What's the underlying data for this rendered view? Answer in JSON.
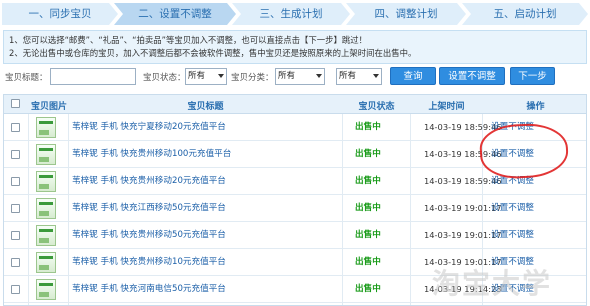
{
  "steps": [
    {
      "label": "一、同步宝贝",
      "active": false
    },
    {
      "label": "二、设置不调整",
      "active": true
    },
    {
      "label": "三、生成计划",
      "active": false
    },
    {
      "label": "四、调整计划",
      "active": false
    },
    {
      "label": "五、启动计划",
      "active": false
    }
  ],
  "notice": {
    "line1": "1、您可以选择“邮费”、“礼品”、“拍卖品”等宝贝加入不调整，也可以直接点击【下一步】跳过！",
    "line2": "2、无论出售中或仓库的宝贝，加入不调整后都不会被软件调整，售中宝贝还是按照原来的上架时间在出售中。"
  },
  "filter": {
    "title_label": "宝贝标题：",
    "title_value": "",
    "status_label": "宝贝状态：",
    "status_value": "所有",
    "category_label": "宝贝分类：",
    "category_value": "所有",
    "extra_value": "所有",
    "query_button": "查询",
    "set_button": "设置不调整",
    "next_button": "下一步"
  },
  "table": {
    "headers": {
      "image": "宝贝图片",
      "title": "宝贝标题",
      "status": "宝贝状态",
      "time": "上架时间",
      "op": "操作"
    },
    "rows": [
      {
        "title": "苇梓铌 手机 快充宁夏移动20元充值平台",
        "status": "出售中",
        "time": "14-03-19 18:59:46",
        "op": "设置不调整"
      },
      {
        "title": "苇梓铌 手机 快充贵州移动100元充值平台",
        "status": "出售中",
        "time": "14-03-19 18:59:46",
        "op": "设置不调整"
      },
      {
        "title": "苇梓铌 手机 快充贵州移动20元充值平台",
        "status": "出售中",
        "time": "14-03-19 18:59:46",
        "op": "设置不调整"
      },
      {
        "title": "苇梓铌 手机 快充江西移动50元充值平台",
        "status": "出售中",
        "time": "14-03-19 19:01:17",
        "op": "设置不调整"
      },
      {
        "title": "苇梓铌 手机 快充贵州移动50元充值平台",
        "status": "出售中",
        "time": "14-03-19 19:01:17",
        "op": "设置不调整"
      },
      {
        "title": "苇梓铌 手机 快充贵州移动10元充值平台",
        "status": "出售中",
        "time": "14-03-19 19:01:17",
        "op": "设置不调整"
      },
      {
        "title": "苇梓铌 手机 快充河南电信50元充值平台",
        "status": "出售中",
        "time": "14-03-19 19:14:23",
        "op": "设置不调整"
      }
    ]
  },
  "watermark": "淘宝大学",
  "colors": {
    "accent": "#2f8de0",
    "status_green": "#179a17",
    "link_blue": "#1b5fa8",
    "annotation_red": "#e02020"
  }
}
